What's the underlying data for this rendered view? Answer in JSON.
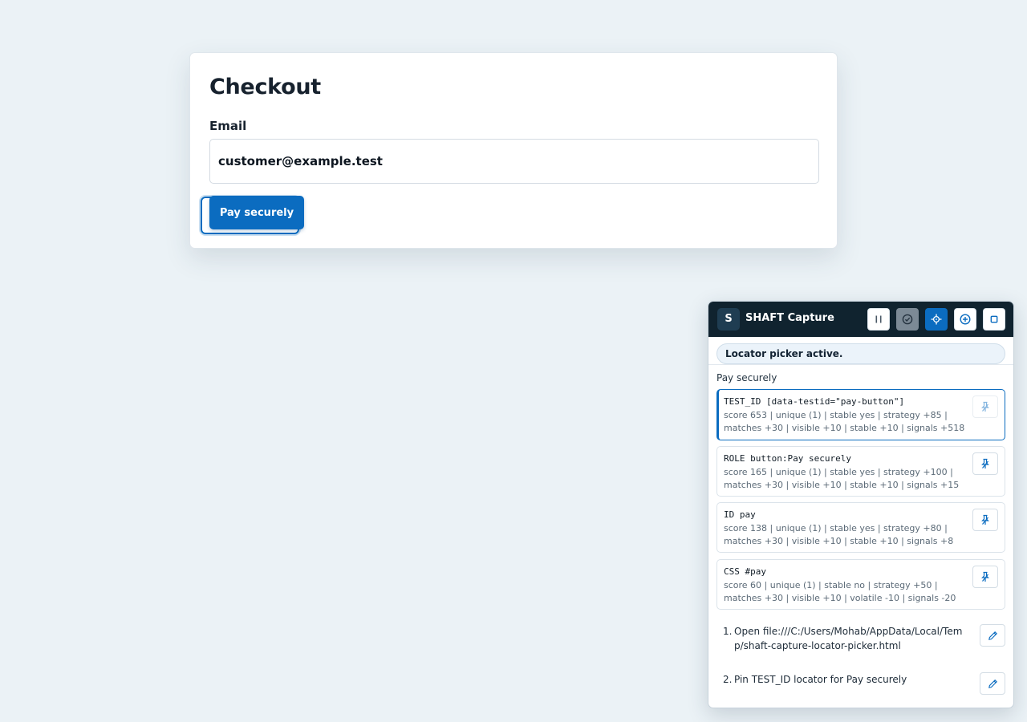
{
  "checkout": {
    "title": "Checkout",
    "email_label": "Email",
    "email_value": "customer@example.test",
    "pay_label": "Pay securely"
  },
  "panel": {
    "logo": "S",
    "title": "SHAFT Capture",
    "toolbar_icons": [
      "pause-icon",
      "verify-icon",
      "crosshair-icon",
      "add-icon",
      "stop-icon"
    ],
    "status": "Locator picker active.",
    "target": "Pay securely",
    "locators": [
      {
        "title": "TEST_ID [data-testid=\"pay-button\"]",
        "meta": "score 653 | unique (1) | stable yes | strategy +85 | matches +30 | visible +10 | stable +10 | signals +518",
        "selected": true
      },
      {
        "title": "ROLE button:Pay securely",
        "meta": "score 165 | unique (1) | stable yes | strategy +100 | matches +30 | visible +10 | stable +10 | signals +15",
        "selected": false
      },
      {
        "title": "ID pay",
        "meta": "score 138 | unique (1) | stable yes | strategy +80 | matches +30 | visible +10 | stable +10 | signals +8",
        "selected": false
      },
      {
        "title": "CSS #pay",
        "meta": "score 60 | unique (1) | stable no | strategy +50 | matches +30 | visible +10 | volatile -10 | signals -20",
        "selected": false
      }
    ],
    "steps": [
      {
        "num": "1.",
        "text": "Open file:///C:/Users/Mohab/AppData/Local/Temp/shaft-capture-locator-picker.html"
      },
      {
        "num": "2.",
        "text": "Pin TEST_ID locator for Pay securely"
      }
    ]
  },
  "colors": {
    "accent": "#0b6cc0",
    "header": "#10232f",
    "background": "#ebf2f6"
  }
}
